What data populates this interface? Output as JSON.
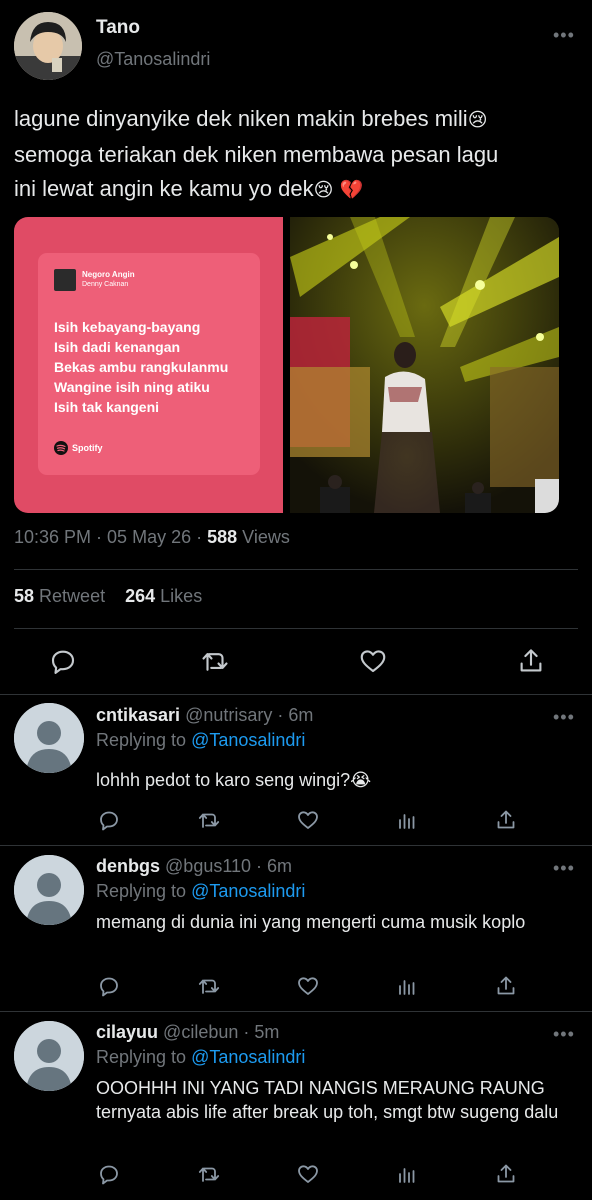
{
  "tweet": {
    "author_name": "Tano",
    "author_handle": "@Tanosalindri",
    "text_line1": "lagune dinyanyike dek niken makin brebes mili",
    "text_line2": "semoga teriakan dek niken membawa pesan lagu",
    "text_line3": "ini lewat angin ke kamu yo dek",
    "emoji_cry": "😢",
    "emoji_broken_heart": "💔",
    "time": "10:36 PM",
    "date": "05 May 26",
    "views_count": "588",
    "views_label": "Views",
    "retweets_count": "58",
    "retweets_label": "Retweet",
    "likes_count": "264",
    "likes_label": "Likes",
    "more": "•••"
  },
  "lyric_card": {
    "song_title": "Negoro Angin",
    "artist": "Denny Caknan",
    "lines": [
      "Isih kebayang-bayang",
      "Isih dadi kenangan",
      "Bekas ambu rangkulanmu",
      "Wangine isih ning atiku",
      "Isih tak kangeni"
    ],
    "brand": "Spotify"
  },
  "replies": [
    {
      "name": "cntikasari",
      "handle": "@nutrisary",
      "time": "6m",
      "replying_label": "Replying to",
      "replying_handle": "@Tanosalindri",
      "text": "lohhh pedot to karo seng wingi?😭"
    },
    {
      "name": "denbgs",
      "handle": "@bgus110",
      "time": "6m",
      "replying_label": "Replying to",
      "replying_handle": "@Tanosalindri",
      "text": "memang di dunia ini yang mengerti cuma musik koplo"
    },
    {
      "name": "cilayuu",
      "handle": "@cilebun",
      "time": "5m",
      "replying_label": "Replying to",
      "replying_handle": "@Tanosalindri",
      "text": "OOOHHH INI YANG TADI NANGIS MERAUNG RAUNG ternyata abis life after break up toh, smgt btw sugeng dalu"
    }
  ],
  "separator": " · ",
  "colors": {
    "background": "#000000",
    "text": "#e7e9ea",
    "muted": "#71767b",
    "link": "#1d9bf0",
    "divider": "#2f3336",
    "lyric_card_bg": "#e04b65"
  },
  "icons": [
    "more-icon",
    "reply-icon",
    "retweet-icon",
    "like-icon",
    "share-icon",
    "views-icon",
    "spotify-icon"
  ]
}
